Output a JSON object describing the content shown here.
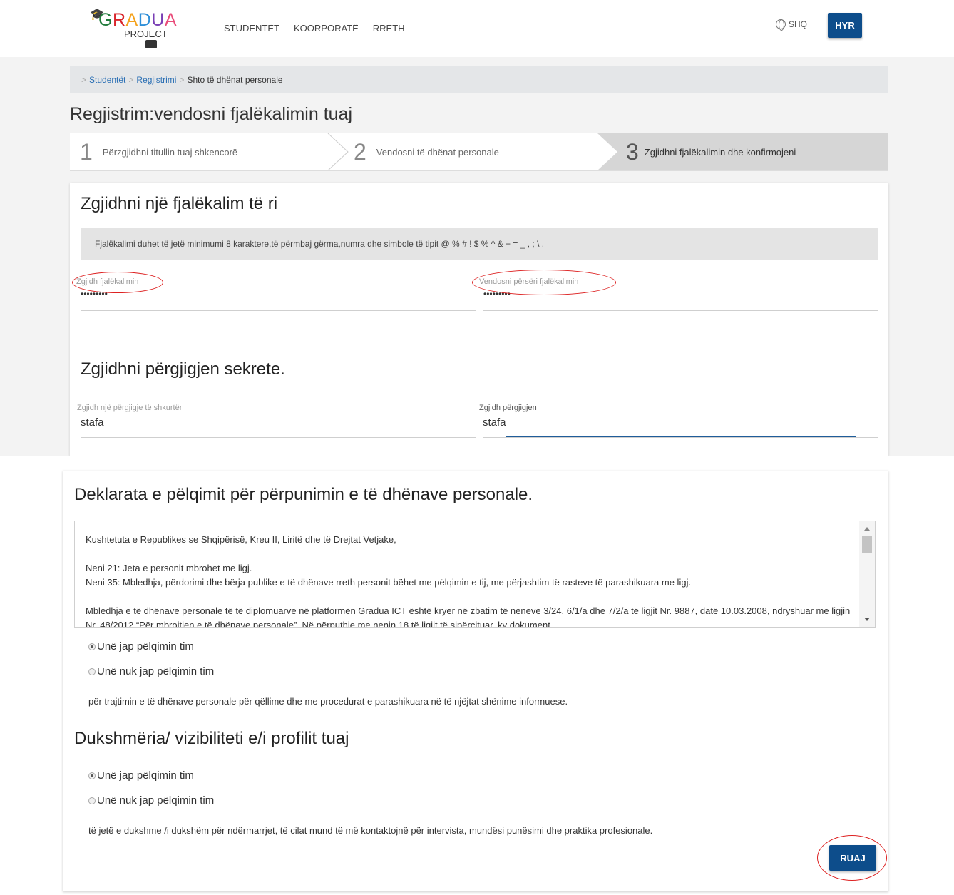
{
  "header": {
    "logo": {
      "word": [
        "G",
        "R",
        "A",
        "D",
        "U",
        "A"
      ],
      "colors": [
        "#1f7a3a",
        "#d9252b",
        "#f4a21d",
        "#2f8fd8",
        "#7a3fb5",
        "#e94c7a"
      ],
      "sub": "PROJECT"
    },
    "nav": [
      "STUDENTËT",
      "KOORPORATË",
      "RRETH"
    ],
    "lang": "SHQ",
    "login": "HYR"
  },
  "breadcrumb": {
    "sep": ">",
    "items": [
      "Studentët",
      "Regjistrimi"
    ],
    "current": "Shto të dhënat personale"
  },
  "page_title": "Regjistrim:vendosni fjalëkalimin tuaj",
  "steps": [
    {
      "num": "1",
      "label": "Përzgjidhni titullin tuaj shkencorë"
    },
    {
      "num": "2",
      "label": "Vendosni të dhënat personale"
    },
    {
      "num": "3",
      "label": "Zgjidhni fjalëkalimin dhe konfirmojeni"
    }
  ],
  "password_section": {
    "title": "Zgjidhni një fjalëkalim të ri",
    "notice": "Fjalëkalimi duhet të jetë minimumi 8 karaktere,të përmbaj gërma,numra dhe simbole të tipit @ % # ! $ % ^ & + = _ , ; \\ .",
    "field1_label": "Zgjidh fjalëkalimin",
    "field1_value": "•••••••••",
    "field2_label": "Vendosni përsëri fjalëkalimin",
    "field2_value": "•••••••••"
  },
  "secret_section": {
    "title": "Zgjidhni përgjigjen sekrete.",
    "field1_label": "Zgjidh një përgjigje të shkurtër",
    "field1_value": "stafa",
    "field2_label": "Zgjidh përgjigjen",
    "field2_value": "stafa"
  },
  "consent_section": {
    "title": "Deklarata e pëlqimit për përpunimin e të dhënave personale.",
    "text": [
      "Kushtetuta e Republikes se Shqipërisë, Kreu II, Liritë dhe të Drejtat Vetjake,",
      "Neni 21: Jeta e personit mbrohet me ligj.",
      "Neni 35: Mbledhja, përdorimi dhe bërja publike e të dhënave rreth personit bëhet me pëlqimin e tij, me përjashtim të rasteve të parashikuara me ligj.",
      "Mbledhja e të dhënave personale të të diplomuarve në platformën Gradua ICT është kryer në zbatim të neneve 3/24, 6/1/a dhe 7/2/a të ligjit Nr. 9887, datë 10.03.2008, ndryshuar me ligjin Nr. 48/2012 “Për mbrojtjen e të dhënave personale”. Në përputhje me nenin 18 të ligjit të sipërcituar, ky dokument"
    ],
    "option_yes": "Unë jap pëlqimin tim",
    "option_no": "Unë nuk jap pëlqimin tim",
    "note": "për trajtimin e të dhënave personale për qëllime dhe me procedurat e parashikuara në të njëjtat shënime informuese."
  },
  "visibility_section": {
    "title": "Dukshmëria/ vizibiliteti e/i profilit tuaj",
    "option_yes": "Unë jap pëlqimin tim",
    "option_no": "Unë nuk jap pëlqimin tim",
    "note": "të jetë e dukshme /i dukshëm për ndërmarrjet, të cilat mund të më kontaktojnë për intervista, mundësi punësimi dhe praktika profesionale."
  },
  "save_button": "RUAJ",
  "colors": {
    "primary": "#0d4d8b",
    "link": "#2a6fb4",
    "annotation": "#dd2222"
  }
}
